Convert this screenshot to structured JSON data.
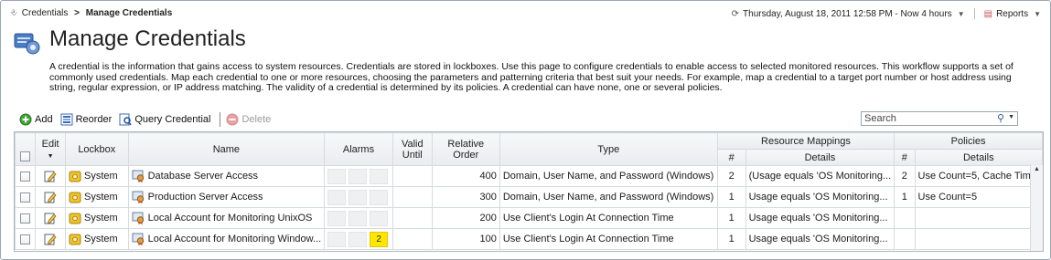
{
  "breadcrumb": {
    "parent": "Credentials",
    "separator": ">",
    "current": "Manage Credentials"
  },
  "header": {
    "datetime": "Thursday, August 18, 2011 12:58 PM - Now 4 hours",
    "reports_label": "Reports"
  },
  "page": {
    "title": "Manage Credentials",
    "description": "A credential is the information that gains access to system resources. Credentials are stored in lockboxes. Use this page to configure credentials to enable access to selected monitored resources. This workflow supports a set of commonly used credentials. Map each credential to one or more resources, choosing the parameters and patterning criteria that best suit your needs. For example, map a credential to a target port number or host address using string, regular expression, or IP address matching. The validity of a credential is determined by its policies. A credential can have none, one or several policies."
  },
  "toolbar": {
    "add_label": "Add",
    "reorder_label": "Reorder",
    "query_label": "Query Credential",
    "delete_label": "Delete"
  },
  "search": {
    "placeholder": "Search"
  },
  "table": {
    "headers": {
      "edit": "Edit",
      "lockbox": "Lockbox",
      "name": "Name",
      "alarms": "Alarms",
      "valid_until_1": "Valid",
      "valid_until_2": "Until",
      "relative_order_1": "Relative",
      "relative_order_2": "Order",
      "type": "Type",
      "resource_mappings": "Resource Mappings",
      "rm_count": "#",
      "rm_details": "Details",
      "policies": "Policies",
      "pol_count": "#",
      "pol_details": "Details"
    },
    "rows": [
      {
        "lockbox": "System",
        "name": "Database Server Access",
        "alarm_count": "",
        "valid_until": "",
        "order": "400",
        "type": "Domain, User Name, and Password (Windows)",
        "rm_count": "2",
        "rm_details": "(Usage equals 'OS Monitoring...",
        "pol_count": "2",
        "pol_details": "Use Count=5, Cache Tim..."
      },
      {
        "lockbox": "System",
        "name": "Production Server Access",
        "alarm_count": "",
        "valid_until": "",
        "order": "300",
        "type": "Domain, User Name, and Password (Windows)",
        "rm_count": "1",
        "rm_details": "Usage equals 'OS Monitoring...",
        "pol_count": "1",
        "pol_details": "Use Count=5"
      },
      {
        "lockbox": "System",
        "name": "Local Account for Monitoring UnixOS",
        "alarm_count": "",
        "valid_until": "",
        "order": "200",
        "type": "Use Client's Login At Connection Time",
        "rm_count": "1",
        "rm_details": "Usage equals 'OS Monitoring...",
        "pol_count": "",
        "pol_details": ""
      },
      {
        "lockbox": "System",
        "name": "Local Account for Monitoring Window...",
        "alarm_count": "2",
        "valid_until": "",
        "order": "100",
        "type": "Use Client's Login At Connection Time",
        "rm_count": "1",
        "rm_details": "Usage equals 'OS Monitoring...",
        "pol_count": "",
        "pol_details": ""
      }
    ]
  },
  "colors": {
    "alarm_warning": "#ffe600",
    "accent_blue": "#2a5aa8"
  }
}
